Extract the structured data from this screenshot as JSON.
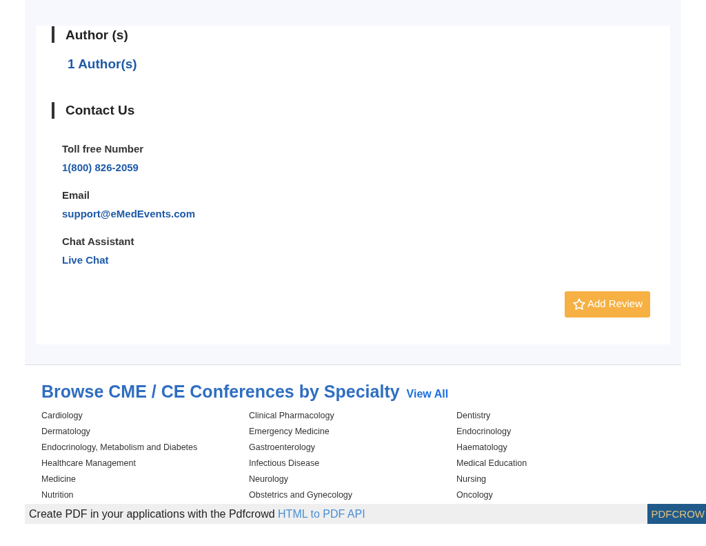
{
  "authors": {
    "heading": "Author (s)",
    "link": "1 Author(s)"
  },
  "contact": {
    "heading": "Contact Us",
    "items": [
      {
        "label": "Toll free Number",
        "value": "1(800) 826-2059"
      },
      {
        "label": "Email",
        "value": "support@eMedEvents.com"
      },
      {
        "label": "Chat Assistant",
        "value": "Live Chat"
      }
    ]
  },
  "review_button": "Add Review",
  "browse": {
    "title": "Browse CME / CE Conferences by Specialty",
    "view_all": "View All",
    "specialties": [
      "Cardiology",
      "Clinical Pharmacology",
      "Dentistry",
      "Dermatology",
      "Emergency Medicine",
      "Endocrinology",
      "Endocrinology, Metabolism and Diabetes",
      "Gastroenterology",
      "Haematology",
      "Healthcare Management",
      "Infectious Disease",
      "Medical Education",
      "Medicine",
      "Neurology",
      "Nursing",
      "Nutrition",
      "Obstetrics and Gynecology",
      "Oncology"
    ]
  },
  "pdf_bar": {
    "text": "Create PDF in your applications with the Pdfcrowd",
    "link": "HTML to PDF API",
    "badge": "PDFCROW"
  }
}
